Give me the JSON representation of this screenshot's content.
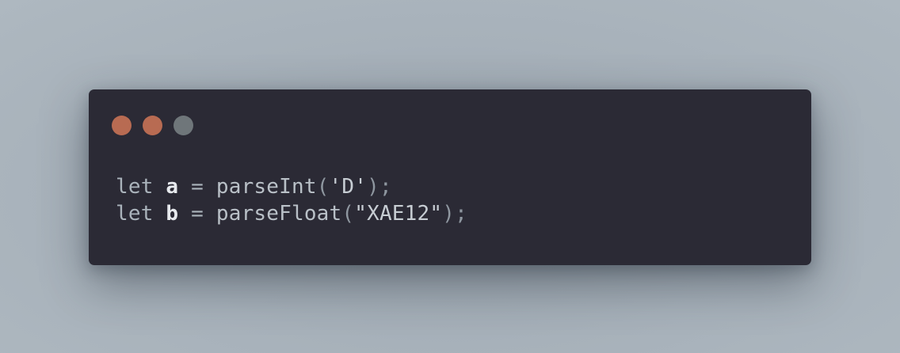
{
  "window": {
    "controls": [
      {
        "name": "close",
        "color": "#b86b52"
      },
      {
        "name": "minimize",
        "color": "#b86b52"
      },
      {
        "name": "maximize",
        "color": "#6f767a"
      }
    ]
  },
  "code": {
    "lines": [
      {
        "keyword": "let",
        "variable": "a",
        "operator": "=",
        "function": "parseInt",
        "open_paren": "(",
        "argument": "'D'",
        "close": ");"
      },
      {
        "keyword": "let",
        "variable": "b",
        "operator": "=",
        "function": "parseFloat",
        "open_paren": "(",
        "argument": "\"XAE12\"",
        "close": ");"
      }
    ]
  }
}
